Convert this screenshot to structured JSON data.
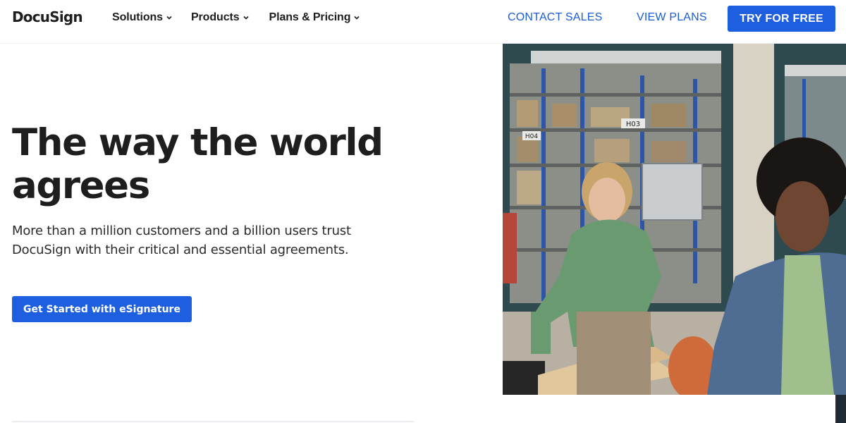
{
  "header": {
    "logo": "DocuSign",
    "nav": [
      {
        "label": "Solutions"
      },
      {
        "label": "Products"
      },
      {
        "label": "Plans & Pricing"
      }
    ],
    "contact_sales": "CONTACT SALES",
    "view_plans": "VIEW PLANS",
    "try_free": "TRY FOR FREE"
  },
  "hero": {
    "title": "The way the world agrees",
    "subtitle": "More than a million customers and a billion users trust DocuSign with their critical and essential agreements.",
    "cta": "Get Started with eSignature"
  },
  "photo": {
    "shelf_labels": [
      "H03",
      "H04"
    ]
  },
  "colors": {
    "accent": "#1e5fe0",
    "link": "#1a5cd8",
    "text": "#1e1e1e"
  }
}
